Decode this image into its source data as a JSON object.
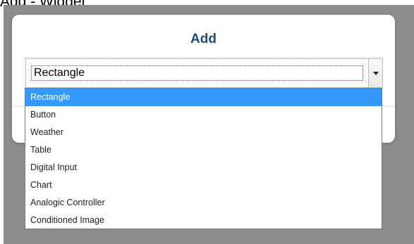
{
  "page": {
    "title": "Add - Widget"
  },
  "modal": {
    "title": "Add",
    "select": {
      "value": "Rectangle",
      "options": [
        "Rectangle",
        "Button",
        "Weather",
        "Table",
        "Digital Input",
        "Chart",
        "Analogic Controller",
        "Conditioned Image"
      ],
      "selected_index": 0
    }
  },
  "colors": {
    "accent": "#3399ff",
    "title": "#1f4e79",
    "overlay": "#8c8c8c"
  },
  "icons": {
    "select_arrow": "chevron-down-icon"
  }
}
